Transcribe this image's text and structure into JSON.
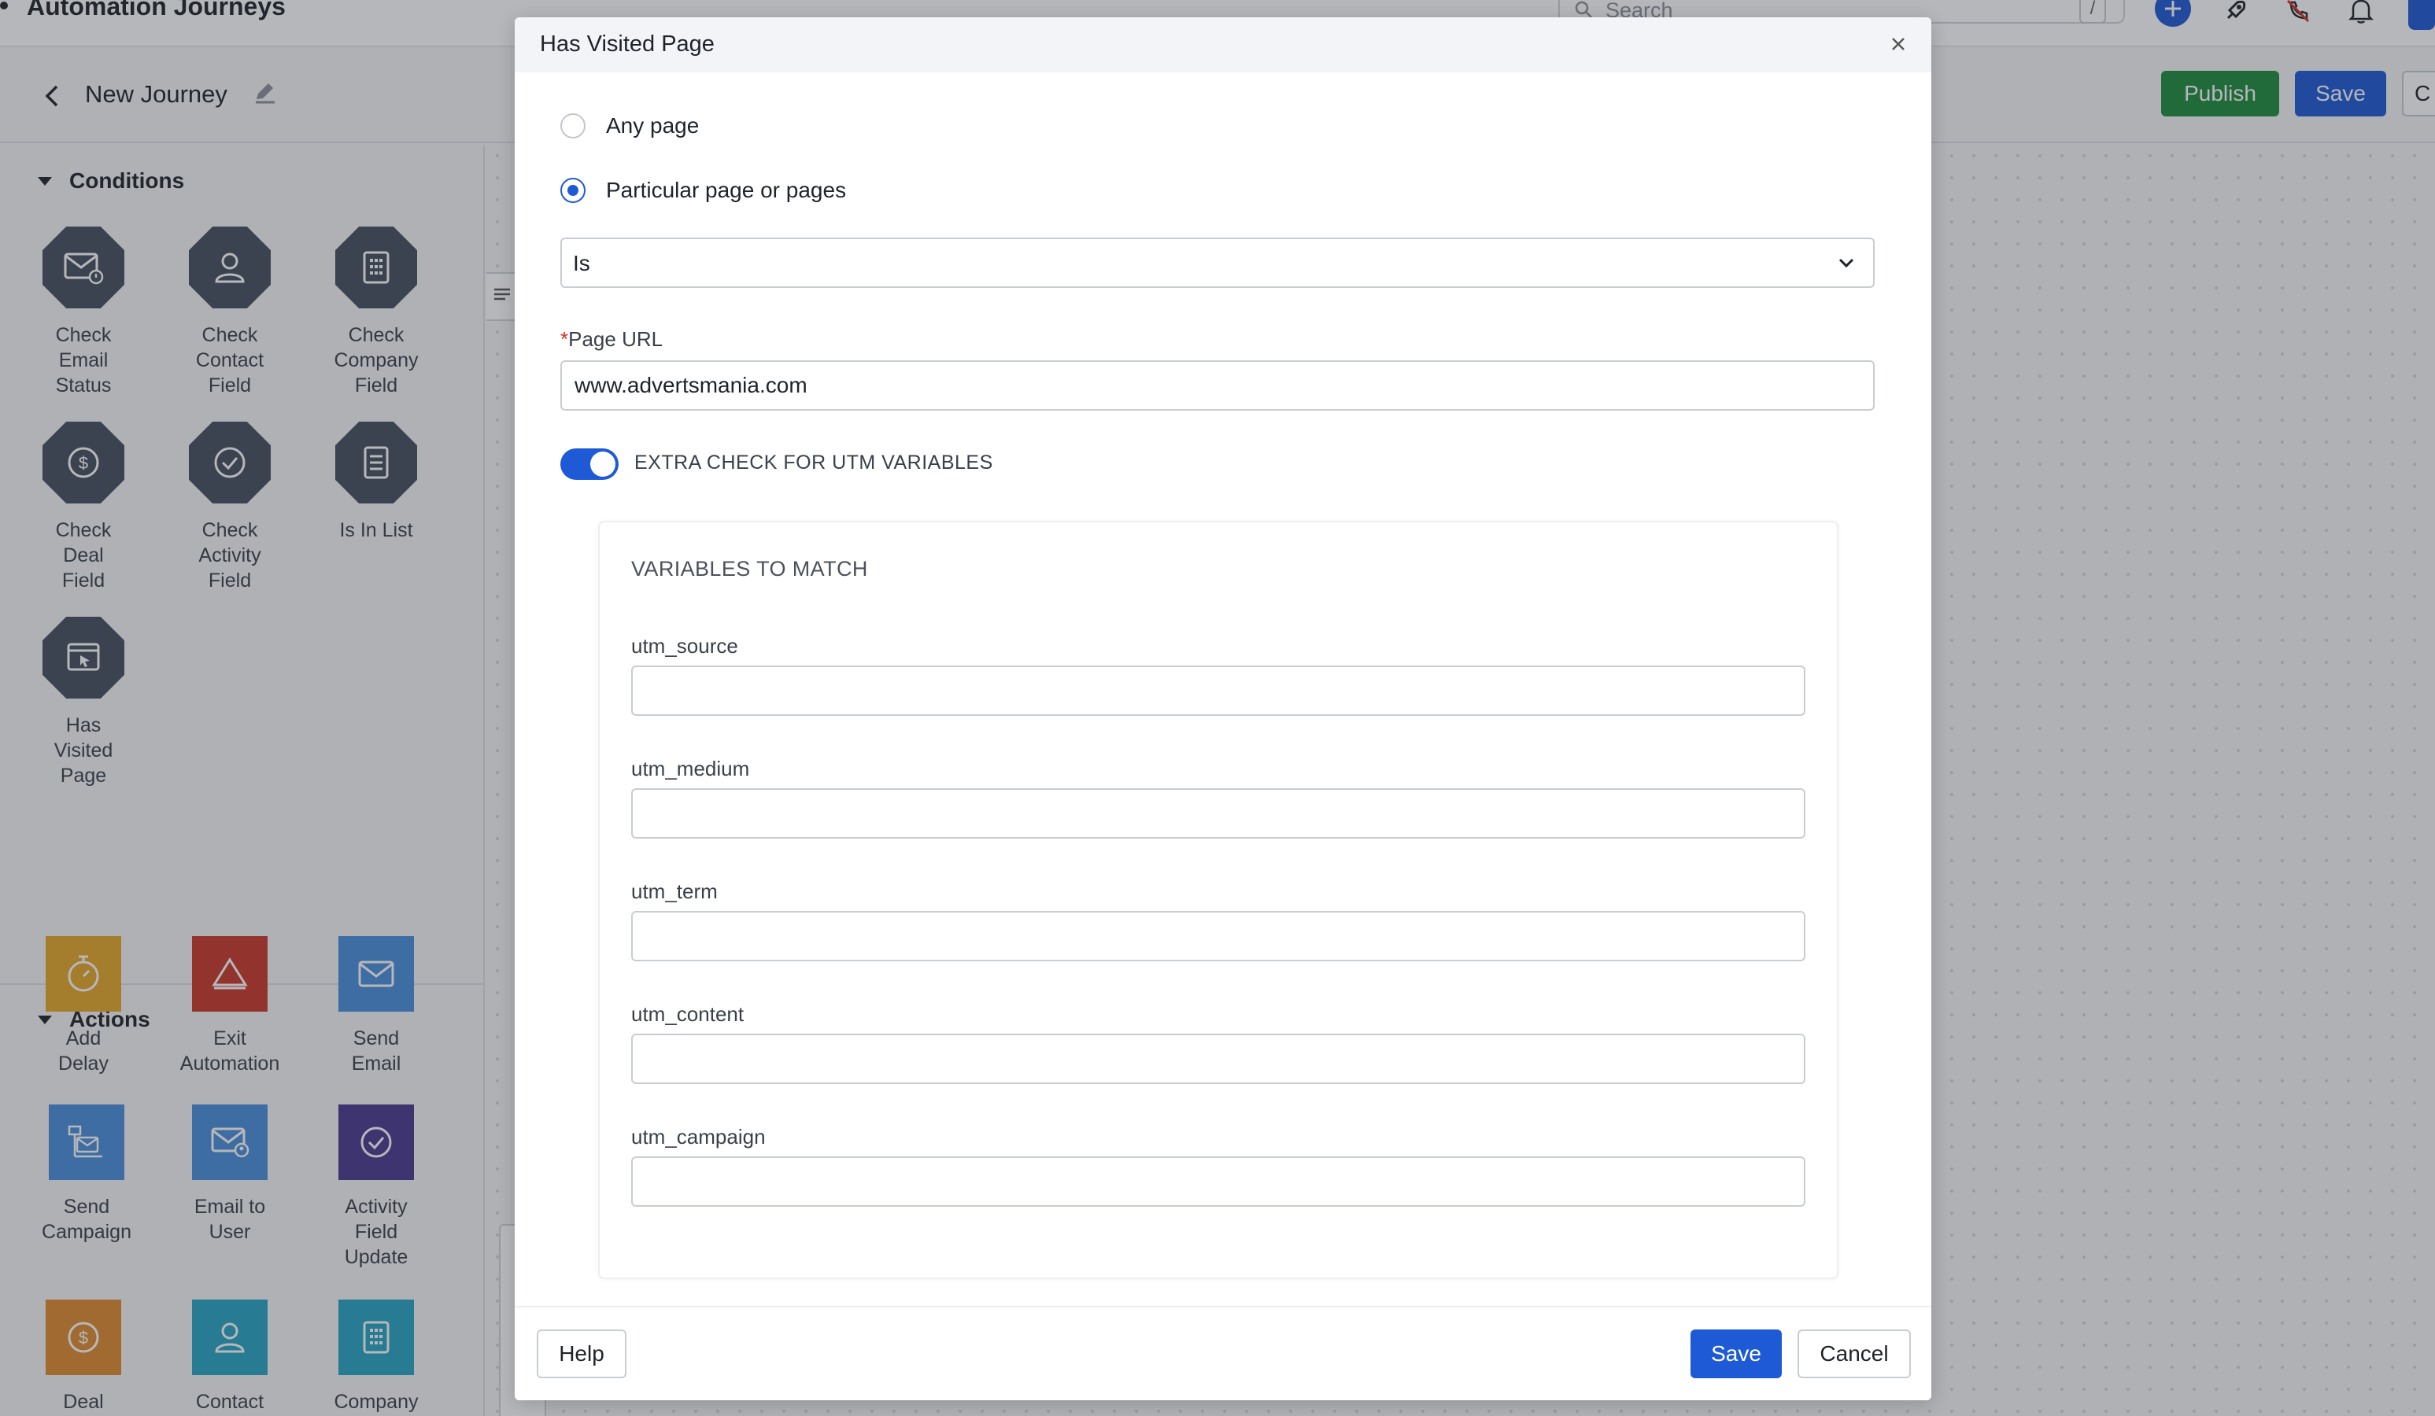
{
  "app": {
    "title": "Automation Journeys",
    "search_placeholder": "Search",
    "search_shortcut": "/",
    "header_icons": [
      "plus-icon",
      "rocket-icon",
      "phone-off-icon",
      "bell-icon"
    ]
  },
  "journey": {
    "name": "New Journey",
    "publish_label": "Publish",
    "save_label": "Save",
    "more_label": "C"
  },
  "sidebar": {
    "conditions_title": "Conditions",
    "conditions": [
      {
        "label": "Check\nEmail\nStatus",
        "icon": "email-status-icon"
      },
      {
        "label": "Check\nContact\nField",
        "icon": "contact-icon"
      },
      {
        "label": "Check\nCompany\nField",
        "icon": "company-icon"
      },
      {
        "label": "Check\nDeal\nField",
        "icon": "dollar-icon"
      },
      {
        "label": "Check\nActivity\nField",
        "icon": "check-circle-icon"
      },
      {
        "label": "Is In List",
        "icon": "list-icon"
      },
      {
        "label": "Has\nVisited\nPage",
        "icon": "browser-cursor-icon"
      }
    ],
    "actions_title": "Actions",
    "actions": [
      {
        "label": "Add\nDelay",
        "icon": "stopwatch-icon",
        "color": "#e4a82a"
      },
      {
        "label": "Exit\nAutomation",
        "icon": "exit-icon",
        "color": "#c9382a"
      },
      {
        "label": "Send\nEmail",
        "icon": "envelope-icon",
        "color": "#4a8fdd"
      },
      {
        "label": "Send\nCampaign",
        "icon": "campaign-icon",
        "color": "#4a8fdd"
      },
      {
        "label": "Email to\nUser",
        "icon": "email-user-icon",
        "color": "#4a8fdd"
      },
      {
        "label": "Activity\nField\nUpdate",
        "icon": "check-circle-icon",
        "color": "#4a3b8f"
      },
      {
        "label": "Deal\nField",
        "icon": "dollar-icon",
        "color": "#e08a2e"
      },
      {
        "label": "Contact\nField",
        "icon": "contact-icon",
        "color": "#27a4c4"
      },
      {
        "label": "Company\nField",
        "icon": "company-icon",
        "color": "#27a4c4"
      }
    ]
  },
  "modal": {
    "title": "Has Visited Page",
    "options": {
      "any_page": "Any page",
      "particular_pages": "Particular page or pages",
      "selected": "particular_pages"
    },
    "operator_value": "Is",
    "page_url_label": "Page URL",
    "page_url_value": "www.advertsmania.com",
    "utm_toggle_label": "EXTRA CHECK FOR UTM VARIABLES",
    "utm_toggle_on": true,
    "utm_section_title": "VARIABLES TO MATCH",
    "utm_fields": [
      {
        "label": "utm_source",
        "value": ""
      },
      {
        "label": "utm_medium",
        "value": ""
      },
      {
        "label": "utm_term",
        "value": ""
      },
      {
        "label": "utm_content",
        "value": ""
      },
      {
        "label": "utm_campaign",
        "value": ""
      }
    ],
    "footer": {
      "help_label": "Help",
      "save_label": "Save",
      "cancel_label": "Cancel"
    }
  },
  "colors": {
    "primary": "#1e5ad6",
    "publish": "#1e8a3e",
    "condition_icon": "#46505f"
  }
}
